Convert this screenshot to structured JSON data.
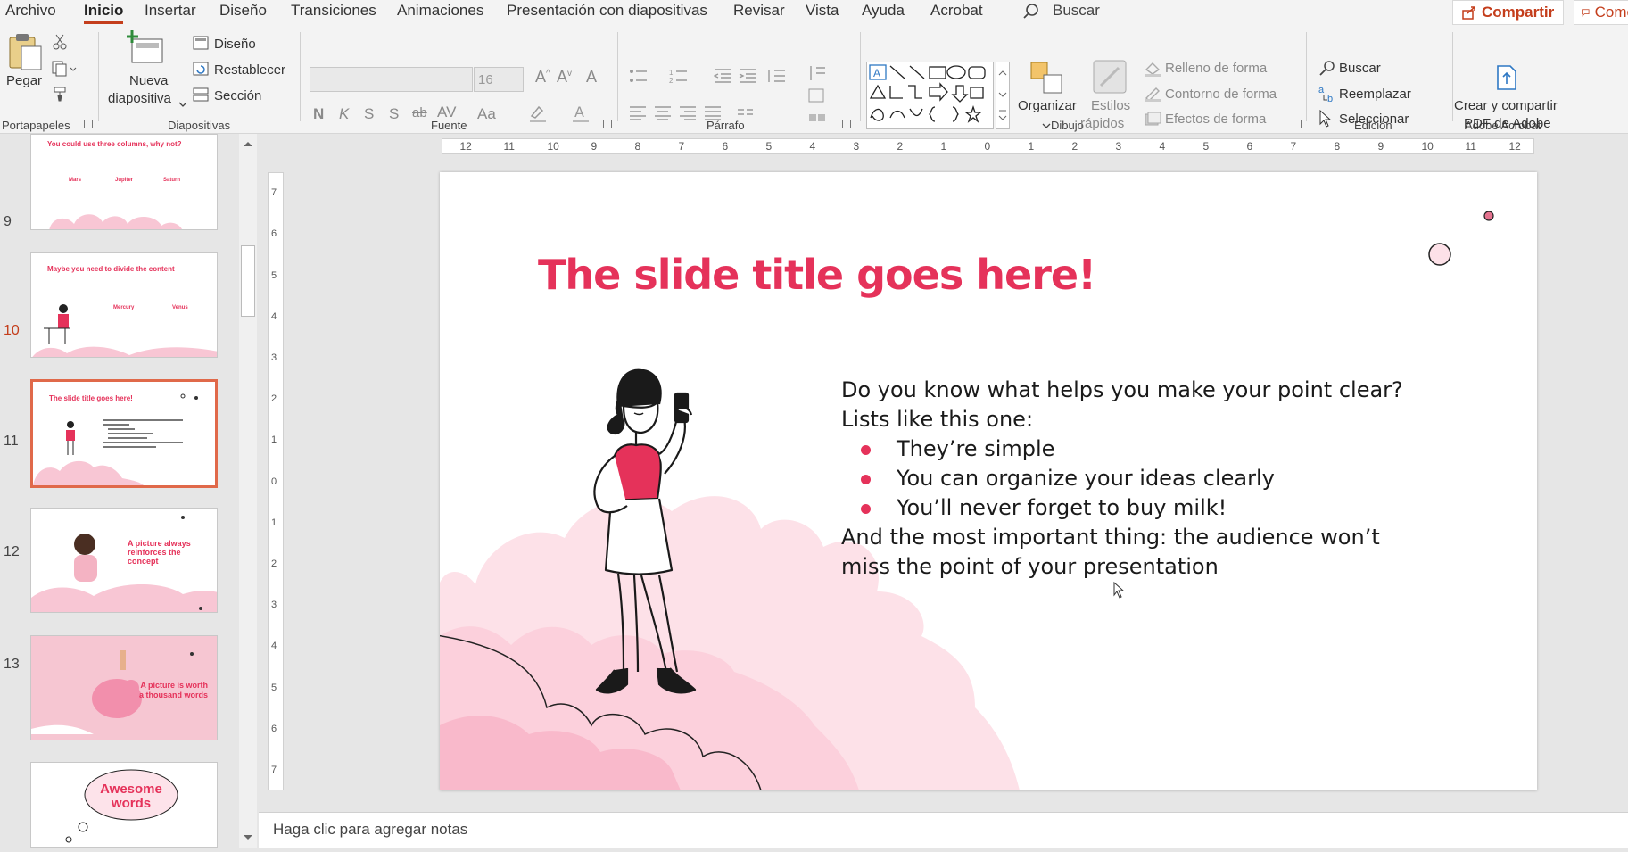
{
  "tabs": [
    "Archivo",
    "Inicio",
    "Insertar",
    "Diseño",
    "Transiciones",
    "Animaciones",
    "Presentación con diapositivas",
    "Revisar",
    "Vista",
    "Ayuda",
    "Acrobat"
  ],
  "search_label": "Buscar",
  "share_label": "Compartir",
  "comments_label": "Come",
  "ribbon": {
    "portapapeles": {
      "paste": "Pegar",
      "group": "Portapapeles"
    },
    "diapositivas": {
      "new_slide_1": "Nueva",
      "new_slide_2": "diapositiva",
      "layout": "Diseño",
      "reset": "Restablecer",
      "section": "Sección",
      "group": "Diapositivas"
    },
    "fuente": {
      "size": "16",
      "bold": "N",
      "italic": "K",
      "underline": "S",
      "shadow": "S",
      "strike": "ab",
      "spacing": "AV",
      "case": "Aa",
      "group": "Fuente"
    },
    "parrafo": {
      "group": "Párrafo"
    },
    "dibujo": {
      "arrange": "Organizar",
      "styles_1": "Estilos",
      "styles_2": "rápidos",
      "fill": "Relleno de forma",
      "outline": "Contorno de forma",
      "effects": "Efectos de forma",
      "group": "Dibujo"
    },
    "edicion": {
      "find": "Buscar",
      "replace": "Reemplazar",
      "select": "Seleccionar",
      "group": "Edición"
    },
    "acrobat": {
      "create_1": "Crear y compartir",
      "create_2": "PDF de Adobe",
      "group": "Adobe Acrobat"
    }
  },
  "thumbnails": [
    {
      "num": "",
      "title": "You could use three columns, why not?",
      "cols": [
        "Mars",
        "Jupiter",
        "Saturn"
      ]
    },
    {
      "num": "9",
      "title": "Maybe you need to divide the content",
      "cols": [
        "Mercury",
        "Venus"
      ]
    },
    {
      "num": "10",
      "title": "The slide title goes here!"
    },
    {
      "num": "11",
      "title": "A picture always reinforces the concept"
    },
    {
      "num": "12",
      "title": "A picture is worth a thousand words"
    },
    {
      "num": "13",
      "title": "Awesome words"
    }
  ],
  "slide": {
    "title": "The slide title goes here!",
    "intro_1": "Do you know what helps you make your point clear?",
    "intro_2": "Lists like this one:",
    "bullets": [
      "They’re simple",
      "You can organize your ideas clearly",
      "You’ll never forget to buy milk!"
    ],
    "outro_1": "And the most important thing: the audience won’t",
    "outro_2": "miss the point of your presentation"
  },
  "hruler_labels": [
    "12",
    "11",
    "10",
    "9",
    "8",
    "7",
    "6",
    "5",
    "4",
    "3",
    "2",
    "1",
    "0",
    "1",
    "2",
    "3",
    "4",
    "5",
    "6",
    "7",
    "8",
    "9",
    "10",
    "11",
    "12"
  ],
  "vruler_labels": [
    "7",
    "6",
    "5",
    "4",
    "3",
    "2",
    "1",
    "0",
    "1",
    "2",
    "3",
    "4",
    "5",
    "6",
    "7"
  ],
  "notes_placeholder": "Haga clic para agregar notas",
  "colors": {
    "accent": "#e5325a",
    "pink_light": "#fce1e8",
    "pink_mid": "#f8c6d4",
    "selection": "#e0694a"
  }
}
